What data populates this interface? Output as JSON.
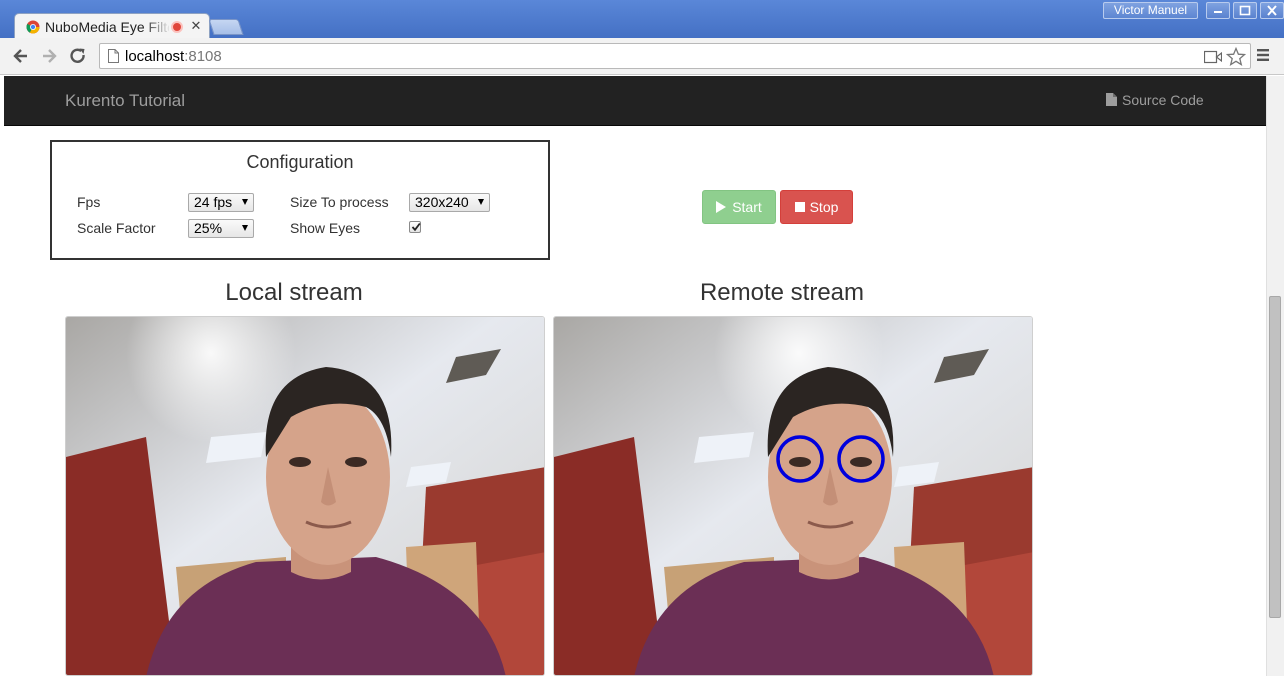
{
  "window": {
    "user_name": "Victor Manuel"
  },
  "tab": {
    "title": "NuboMedia Eye Filter",
    "favicon": "chrome-favicon",
    "recording_indicator": "record-icon"
  },
  "toolbar": {
    "url_host": "localhost",
    "url_port": ":8108"
  },
  "navbar": {
    "brand": "Kurento Tutorial",
    "source_code": "Source Code"
  },
  "config": {
    "title": "Configuration",
    "fps_label": "Fps",
    "fps_value": "24 fps",
    "scale_label": "Scale Factor",
    "scale_value": "25%",
    "size_label": "Size To process",
    "size_value": "320x240",
    "show_eyes_label": "Show Eyes",
    "show_eyes_checked": true
  },
  "controls": {
    "start_label": "Start",
    "stop_label": "Stop",
    "start_color": "#8fcf8f",
    "stop_color": "#d9534f"
  },
  "streams": {
    "local_title": "Local stream",
    "remote_title": "Remote stream",
    "eye_marker_color": "#0000dd"
  }
}
